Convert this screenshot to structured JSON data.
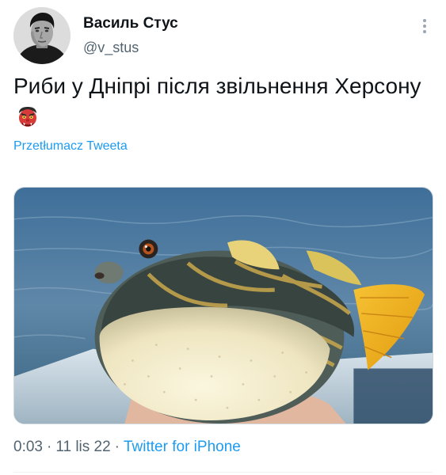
{
  "user": {
    "display_name": "Василь Стус",
    "handle": "@v_stus"
  },
  "tweet": {
    "text": "Риби у Дніпрі після звільнення Херсону",
    "emoji": "japanese-ogre-emoji",
    "translate_label": "Przetłumacz Tweeta",
    "media": {
      "subject": "pufferfish-photo"
    }
  },
  "meta": {
    "time": "0:03",
    "date": "11 lis 22",
    "separator": "·",
    "source": "Twitter for iPhone"
  },
  "icons": {
    "more": "more-vertical-icon"
  },
  "colors": {
    "accent": "#1d9bf0",
    "secondary_text": "#536471",
    "primary_text": "#0f1419"
  }
}
